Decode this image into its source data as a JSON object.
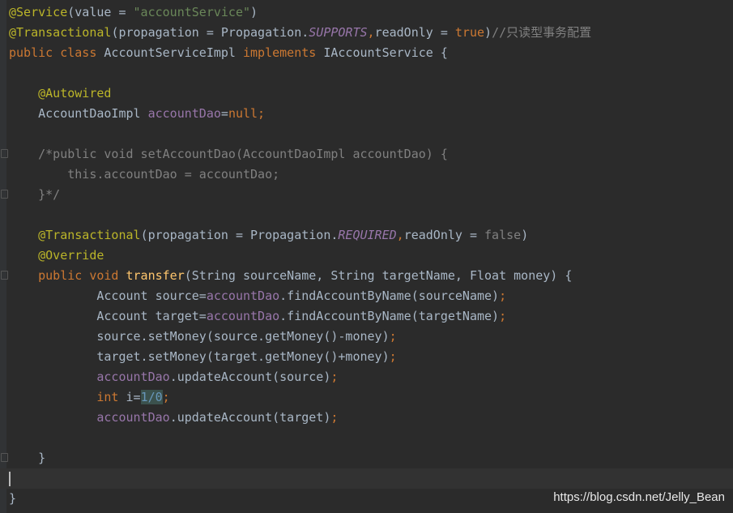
{
  "editor": {
    "lines": [
      {
        "tokens": [
          {
            "t": "@Service",
            "c": "ann"
          },
          {
            "t": "(value = ",
            "c": "plain"
          },
          {
            "t": "\"accountService\"",
            "c": "str"
          },
          {
            "t": ")",
            "c": "plain"
          }
        ]
      },
      {
        "tokens": [
          {
            "t": "@Transactional",
            "c": "ann"
          },
          {
            "t": "(propagation = Propagation.",
            "c": "plain"
          },
          {
            "t": "SUPPORTS",
            "c": "fld ital"
          },
          {
            "t": ",",
            "c": "kw"
          },
          {
            "t": "readOnly = ",
            "c": "plain"
          },
          {
            "t": "true",
            "c": "kw"
          },
          {
            "t": ")",
            "c": "plain"
          },
          {
            "t": "//只读型事务配置",
            "c": "cmt"
          }
        ]
      },
      {
        "tokens": [
          {
            "t": "public class ",
            "c": "kw"
          },
          {
            "t": "AccountServiceImpl ",
            "c": "plain"
          },
          {
            "t": "implements ",
            "c": "kw"
          },
          {
            "t": "IAccountService {",
            "c": "plain"
          }
        ]
      },
      {
        "tokens": []
      },
      {
        "tokens": [
          {
            "t": "    @Autowired",
            "c": "ann"
          }
        ]
      },
      {
        "tokens": [
          {
            "t": "    AccountDaoImpl ",
            "c": "plain"
          },
          {
            "t": "accountDao",
            "c": "fld"
          },
          {
            "t": "=",
            "c": "plain"
          },
          {
            "t": "null;",
            "c": "kw"
          }
        ]
      },
      {
        "tokens": []
      },
      {
        "tokens": [
          {
            "t": "    /*public void setAccountDao(AccountDaoImpl accountDao) {",
            "c": "cmt"
          }
        ]
      },
      {
        "tokens": [
          {
            "t": "        this.accountDao = accountDao;",
            "c": "cmt"
          }
        ]
      },
      {
        "tokens": [
          {
            "t": "    }*/",
            "c": "cmt"
          }
        ]
      },
      {
        "tokens": []
      },
      {
        "tokens": [
          {
            "t": "    @Transactional",
            "c": "ann"
          },
          {
            "t": "(propagation = Propagation.",
            "c": "plain"
          },
          {
            "t": "REQUIRED",
            "c": "fld ital"
          },
          {
            "t": ",",
            "c": "kw"
          },
          {
            "t": "readOnly = ",
            "c": "plain"
          },
          {
            "t": "false",
            "c": "cmt"
          },
          {
            "t": ")",
            "c": "plain"
          }
        ]
      },
      {
        "tokens": [
          {
            "t": "    @Override",
            "c": "ann"
          }
        ]
      },
      {
        "tokens": [
          {
            "t": "    public void ",
            "c": "kw"
          },
          {
            "t": "transfer",
            "c": "fn"
          },
          {
            "t": "(String sourceName, String targetName, Float money) {",
            "c": "plain"
          }
        ]
      },
      {
        "tokens": [
          {
            "t": "            Account source=",
            "c": "plain"
          },
          {
            "t": "accountDao",
            "c": "fld"
          },
          {
            "t": ".findAccountByName(sourceName)",
            "c": "plain"
          },
          {
            "t": ";",
            "c": "kw"
          }
        ]
      },
      {
        "tokens": [
          {
            "t": "            Account target=",
            "c": "plain"
          },
          {
            "t": "accountDao",
            "c": "fld"
          },
          {
            "t": ".findAccountByName(targetName)",
            "c": "plain"
          },
          {
            "t": ";",
            "c": "kw"
          }
        ]
      },
      {
        "tokens": [
          {
            "t": "            source.setMoney(source.getMoney()-money)",
            "c": "plain"
          },
          {
            "t": ";",
            "c": "kw"
          }
        ]
      },
      {
        "tokens": [
          {
            "t": "            target.setMoney(target.getMoney()+money)",
            "c": "plain"
          },
          {
            "t": ";",
            "c": "kw"
          }
        ]
      },
      {
        "tokens": [
          {
            "t": "            ",
            "c": "plain"
          },
          {
            "t": "accountDao",
            "c": "fld"
          },
          {
            "t": ".updateAccount(source)",
            "c": "plain"
          },
          {
            "t": ";",
            "c": "kw"
          }
        ]
      },
      {
        "tokens": [
          {
            "t": "            ",
            "c": "plain"
          },
          {
            "t": "int ",
            "c": "kw"
          },
          {
            "t": "i=",
            "c": "plain"
          },
          {
            "t": "1/0",
            "c": "num hl"
          },
          {
            "t": ";",
            "c": "kw"
          }
        ]
      },
      {
        "tokens": [
          {
            "t": "            ",
            "c": "plain"
          },
          {
            "t": "accountDao",
            "c": "fld"
          },
          {
            "t": ".updateAccount(target)",
            "c": "plain"
          },
          {
            "t": ";",
            "c": "kw"
          }
        ]
      },
      {
        "tokens": []
      },
      {
        "tokens": [
          {
            "t": "    }",
            "c": "plain"
          }
        ]
      },
      {
        "tokens": []
      },
      {
        "tokens": [
          {
            "t": "}",
            "c": "plain"
          }
        ]
      }
    ]
  },
  "watermark": "https://blog.csdn.net/Jelly_Bean"
}
